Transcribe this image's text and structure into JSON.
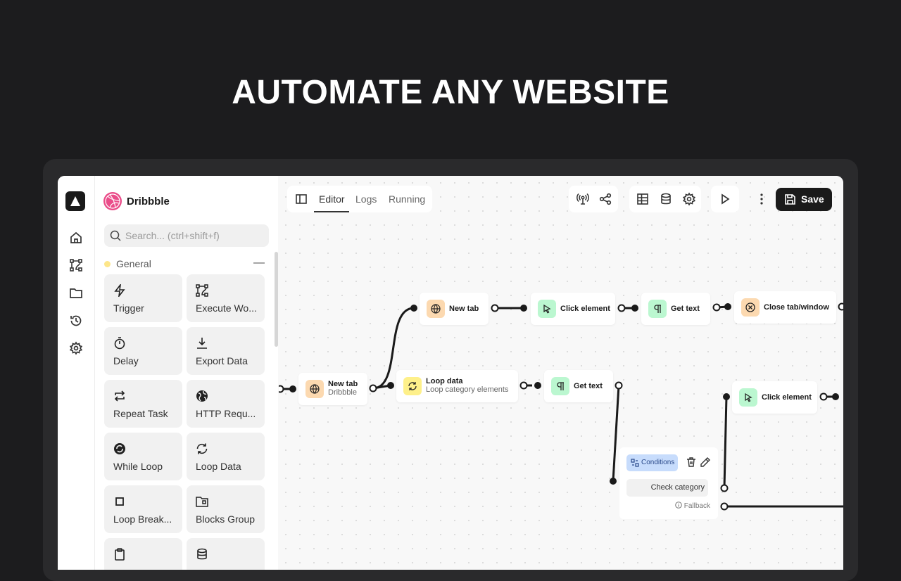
{
  "headline": "AUTOMATE ANY WEBSITE",
  "workspace": {
    "name": "Dribbble"
  },
  "search": {
    "placeholder": "Search... (ctrl+shift+f)"
  },
  "category": {
    "label": "General",
    "collapse_symbol": "—"
  },
  "blocks": [
    {
      "label": "Trigger",
      "icon": "lightning-icon"
    },
    {
      "label": "Execute Wo...",
      "icon": "workflow-icon"
    },
    {
      "label": "Delay",
      "icon": "timer-icon"
    },
    {
      "label": "Export Data",
      "icon": "download-icon"
    },
    {
      "label": "Repeat Task",
      "icon": "repeat-icon"
    },
    {
      "label": "HTTP Requ...",
      "icon": "globe-icon"
    },
    {
      "label": "While Loop",
      "icon": "loop-icon"
    },
    {
      "label": "Loop Data",
      "icon": "refresh-icon"
    },
    {
      "label": "Loop Break...",
      "icon": "stop-icon"
    },
    {
      "label": "Blocks Group",
      "icon": "folder-icon"
    },
    {
      "label": "",
      "icon": "clipboard-icon"
    },
    {
      "label": "",
      "icon": "database-icon"
    }
  ],
  "tabs": {
    "editor": "Editor",
    "logs": "Logs",
    "running": "Running"
  },
  "toolbar": {
    "save_label": "Save"
  },
  "nodes": {
    "new_tab_top": {
      "title": "New tab"
    },
    "click_element_top": {
      "title": "Click element"
    },
    "get_text_top": {
      "title": "Get text"
    },
    "close_tab": {
      "title": "Close tab/window"
    },
    "new_tab_main": {
      "title": "New tab",
      "subtitle": "Dribbble"
    },
    "loop_data": {
      "title": "Loop data",
      "subtitle": "Loop category elements"
    },
    "get_text_mid": {
      "title": "Get text"
    },
    "click_element_right": {
      "title": "Click element"
    },
    "conditions": {
      "badge": "Conditions",
      "condition": "Check category",
      "fallback": "Fallback"
    }
  },
  "colors": {
    "background": "#1c1c1e",
    "app": "#f8f8f8",
    "accent_dark": "#1a1a1a",
    "icon_orange": "#fcd9b0",
    "icon_green": "#bbf7d0",
    "icon_yellow": "#fef08a",
    "conditions_badge": "#c7dcfc",
    "dribbble_pink": "#ea4c89"
  }
}
